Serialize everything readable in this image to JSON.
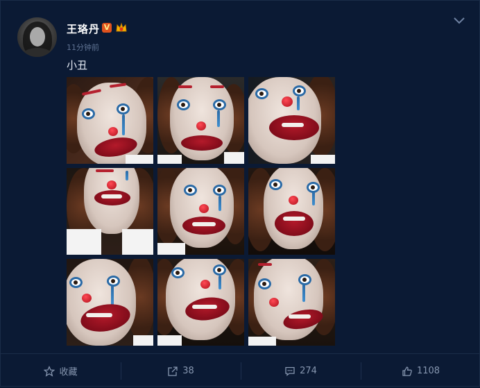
{
  "post": {
    "author": "王珞丹",
    "verified_badge": "V",
    "timestamp": "11分钟前",
    "text": "小丑",
    "image_count": 9,
    "images": [
      {
        "alt": "photo-1"
      },
      {
        "alt": "photo-2"
      },
      {
        "alt": "photo-3"
      },
      {
        "alt": "photo-4"
      },
      {
        "alt": "photo-5"
      },
      {
        "alt": "photo-6"
      },
      {
        "alt": "photo-7"
      },
      {
        "alt": "photo-8"
      },
      {
        "alt": "photo-9"
      }
    ]
  },
  "actions": {
    "favorite_label": "收藏",
    "repost_count": "38",
    "comment_count": "274",
    "like_count": "1108"
  },
  "icons": {
    "more": "chevron-down-icon",
    "favorite": "star-icon",
    "repost": "share-icon",
    "comment": "comment-icon",
    "like": "thumbs-up-icon"
  },
  "colors": {
    "background": "#0b1a34",
    "verified": "#e0531e",
    "muted_text": "#8797b0"
  }
}
